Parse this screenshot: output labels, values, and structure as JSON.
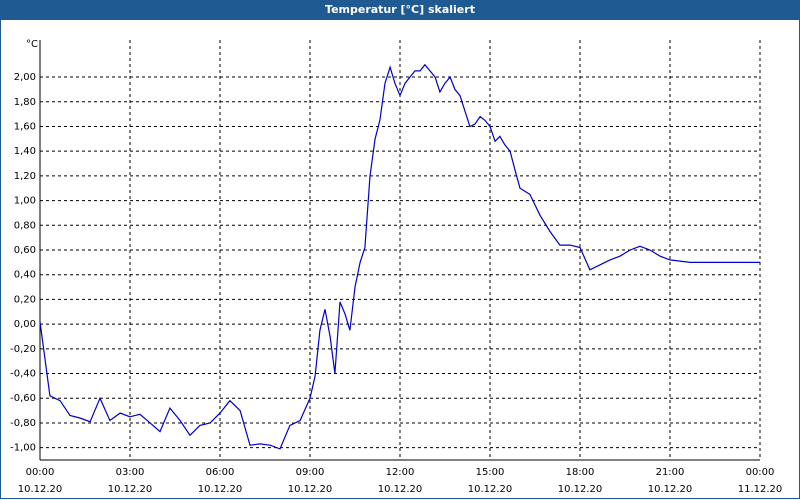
{
  "window": {
    "title": "Temperatur [°C] skaliert"
  },
  "chart_data": {
    "type": "line",
    "title": "Temperatur [°C] skaliert",
    "ylabel": "°C",
    "xlabel": "",
    "xlim": [
      0,
      24
    ],
    "ylim": [
      -1.1,
      2.3
    ],
    "grid": true,
    "legend": "none",
    "line_color": "#0000cc",
    "y_ticks": [
      -1.0,
      -0.8,
      -0.6,
      -0.4,
      -0.2,
      0.0,
      0.2,
      0.4,
      0.6,
      0.8,
      1.0,
      1.2,
      1.4,
      1.6,
      1.8,
      2.0
    ],
    "y_tick_labels": [
      "-1,00",
      "-0,80",
      "-0,60",
      "-0,40",
      "-0,20",
      "0,00",
      "0,20",
      "0,40",
      "0,60",
      "0,80",
      "1,00",
      "1,20",
      "1,40",
      "1,60",
      "1,80",
      "2,00"
    ],
    "x_ticks": [
      0,
      3,
      6,
      9,
      12,
      15,
      18,
      21,
      24
    ],
    "x_tick_labels": [
      [
        "00:00",
        "10.12.20"
      ],
      [
        "03:00",
        "10.12.20"
      ],
      [
        "06:00",
        "10.12.20"
      ],
      [
        "09:00",
        "10.12.20"
      ],
      [
        "12:00",
        "10.12.20"
      ],
      [
        "15:00",
        "10.12.20"
      ],
      [
        "18:00",
        "10.12.20"
      ],
      [
        "21:00",
        "10.12.20"
      ],
      [
        "00:00",
        "11.12.20"
      ]
    ],
    "series": [
      {
        "x": [
          0,
          0.33,
          0.67,
          1.0,
          1.33,
          1.67,
          2.0,
          2.33,
          2.67,
          3.0,
          3.33,
          3.67,
          4.0,
          4.33,
          4.67,
          5.0,
          5.33,
          5.67,
          6.0,
          6.33,
          6.67,
          7.0,
          7.33,
          7.67,
          8.0,
          8.33,
          8.67,
          9.0,
          9.17,
          9.33,
          9.5,
          9.67,
          9.83,
          10.0,
          10.17,
          10.33,
          10.5,
          10.67,
          10.83,
          11.0,
          11.17,
          11.33,
          11.5,
          11.67,
          11.83,
          12.0,
          12.17,
          12.33,
          12.5,
          12.67,
          12.83,
          13.0,
          13.17,
          13.33,
          13.5,
          13.67,
          13.83,
          14.0,
          14.17,
          14.33,
          14.5,
          14.67,
          14.83,
          15.0,
          15.17,
          15.33,
          15.5,
          15.67,
          15.83,
          16.0,
          16.33,
          16.67,
          17.0,
          17.33,
          17.67,
          18.0,
          18.33,
          18.67,
          19.0,
          19.33,
          19.67,
          20.0,
          20.33,
          20.67,
          21.0,
          21.33,
          21.67,
          22.0,
          22.33,
          22.67,
          23.0,
          23.33,
          23.67,
          24.0
        ],
        "y": [
          0.02,
          -0.58,
          -0.62,
          -0.74,
          -0.76,
          -0.79,
          -0.6,
          -0.78,
          -0.72,
          -0.75,
          -0.73,
          -0.8,
          -0.87,
          -0.68,
          -0.78,
          -0.9,
          -0.82,
          -0.8,
          -0.72,
          -0.62,
          -0.7,
          -0.98,
          -0.97,
          -0.98,
          -1.01,
          -0.82,
          -0.78,
          -0.6,
          -0.42,
          -0.05,
          0.12,
          -0.1,
          -0.4,
          0.18,
          0.08,
          -0.05,
          0.3,
          0.5,
          0.62,
          1.2,
          1.5,
          1.65,
          1.95,
          2.08,
          1.95,
          1.85,
          1.95,
          2.0,
          2.05,
          2.05,
          2.1,
          2.05,
          2.0,
          1.88,
          1.95,
          2.0,
          1.9,
          1.85,
          1.72,
          1.6,
          1.62,
          1.68,
          1.65,
          1.6,
          1.48,
          1.52,
          1.45,
          1.4,
          1.25,
          1.1,
          1.05,
          0.88,
          0.75,
          0.64,
          0.64,
          0.62,
          0.44,
          0.48,
          0.52,
          0.55,
          0.6,
          0.63,
          0.6,
          0.55,
          0.52,
          0.51,
          0.5,
          0.5,
          0.5,
          0.5,
          0.5,
          0.5,
          0.5,
          0.5
        ]
      }
    ]
  }
}
